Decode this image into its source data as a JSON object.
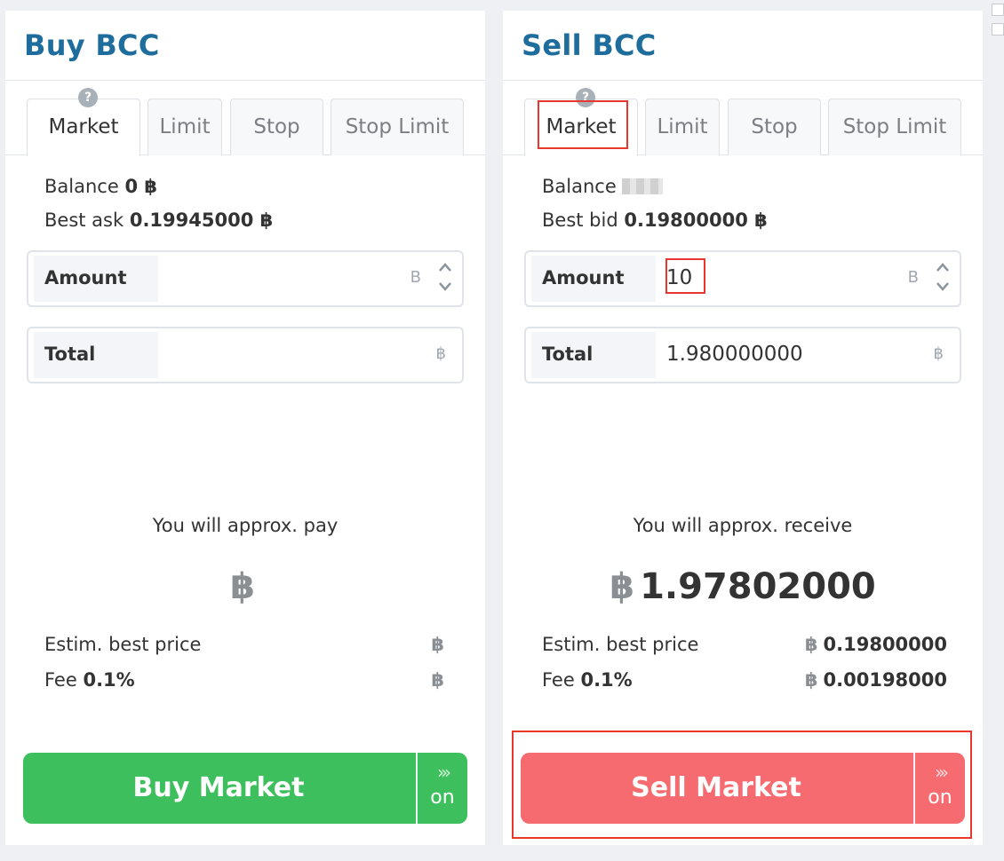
{
  "buy": {
    "title": "Buy BCC",
    "tabs": [
      "Market",
      "Limit",
      "Stop",
      "Stop Limit"
    ],
    "help": "?",
    "balance_label": "Balance",
    "balance_value": "0 ฿",
    "best_label": "Best ask",
    "best_value": "0.19945000 ฿",
    "amount_label": "Amount",
    "amount_value": "",
    "amount_unit": "B",
    "total_label": "Total",
    "total_value": "",
    "total_unit": "฿",
    "approx_text": "You will approx. pay",
    "result_currency": "฿",
    "result_value": "",
    "est_label": "Estim. best price",
    "est_currency": "฿",
    "est_value": "",
    "fee_label": "Fee",
    "fee_pct": "0.1%",
    "fee_currency": "฿",
    "fee_value": "",
    "button_label": "Buy  Market",
    "button_on": "on"
  },
  "sell": {
    "title": "Sell BCC",
    "tabs": [
      "Market",
      "Limit",
      "Stop",
      "Stop Limit"
    ],
    "help": "?",
    "balance_label": "Balance",
    "best_label": "Best bid",
    "best_value": "0.19800000 ฿",
    "amount_label": "Amount",
    "amount_value": "10",
    "amount_unit": "B",
    "total_label": "Total",
    "total_value": "1.980000000",
    "total_unit": "฿",
    "approx_text": "You will approx. receive",
    "result_currency": "฿",
    "result_value": "1.97802000",
    "est_label": "Estim. best price",
    "est_currency": "฿",
    "est_value": "0.19800000",
    "fee_label": "Fee",
    "fee_pct": "0.1%",
    "fee_currency": "฿",
    "fee_value": "0.00198000",
    "button_label": "Sell Market",
    "button_on": "on"
  },
  "colors": {
    "title_blue": "#1e6d9c",
    "buy_green": "#3cbf5c",
    "sell_red": "#f56b70",
    "highlight_red": "#e8372c"
  },
  "icons": {
    "help": "question-circle-icon",
    "spinner": "up-down-chevron-icon",
    "action_side": "triple-chevron-right-icon"
  }
}
